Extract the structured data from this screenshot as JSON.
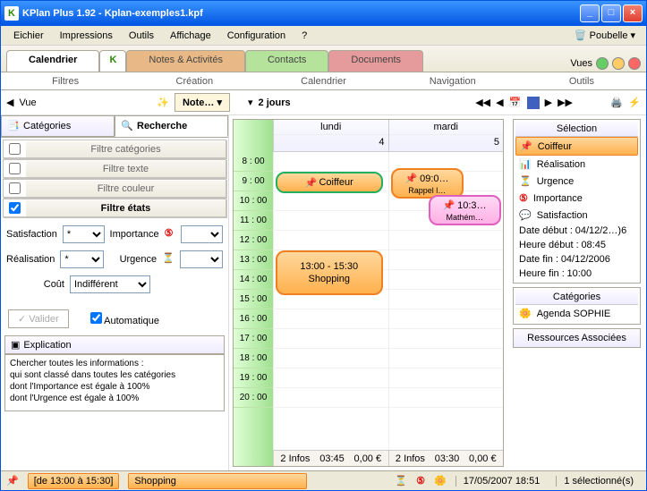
{
  "title": "KPlan Plus 1.92 - Kplan-exemples1.kpf",
  "menu": {
    "eichier": "Eichier",
    "impressions": "Impressions",
    "outils": "Outils",
    "affichage": "Affichage",
    "configuration": "Configuration",
    "help": "?",
    "poubelle": "Poubelle"
  },
  "main_tabs": {
    "calendrier": "Calendrier",
    "notes": "Notes & Activités",
    "contacts": "Contacts",
    "documents": "Documents",
    "vues": "Vues"
  },
  "subheader": {
    "filtres": "Filtres",
    "creation": "Création",
    "calendrier": "Calendrier",
    "navigation": "Navigation",
    "outils": "Outils"
  },
  "toolbar": {
    "vue": "Vue",
    "note": "Note…",
    "period": "2 jours"
  },
  "left": {
    "tabs": {
      "categories": "Catégories",
      "recherche": "Recherche"
    },
    "filters": {
      "cat": "Filtre catégories",
      "texte": "Filtre texte",
      "couleur": "Filtre couleur",
      "etats": "Filtre états"
    },
    "crit": {
      "satisfaction": "Satisfaction",
      "importance": "Importance",
      "realisation": "Réalisation",
      "urgence": "Urgence",
      "cout": "Coût",
      "star": "*",
      "indiff": "Indifférent"
    },
    "valider": "Valider",
    "auto": "Automatique",
    "explic_h": "Explication",
    "explic": "Chercher toutes les informations :\nqui sont classé dans  toutes les catégories\ndont l'Importance est égale à 100%\ndont l'Urgence est égale à 100%"
  },
  "calendar": {
    "days": [
      {
        "name": "lundi",
        "num": "4",
        "footer": {
          "infos": "2 Infos",
          "time": "03:45",
          "cost": "0,00 €"
        }
      },
      {
        "name": "mardi",
        "num": "5",
        "footer": {
          "infos": "2 Infos",
          "time": "03:30",
          "cost": "0,00 €"
        }
      }
    ],
    "hours": [
      "8 : 00",
      "9 : 00",
      "10 : 00",
      "11 : 00",
      "12 : 00",
      "13 : 00",
      "14 : 00",
      "15 : 00",
      "16 : 00",
      "17 : 00",
      "18 : 00",
      "19 : 00",
      "20 : 00"
    ],
    "events": {
      "coiffeur": "Coiffeur",
      "shopping_time": "13:00 - 15:30",
      "shopping": "Shopping",
      "rappel_t": "09:0…",
      "rappel": "Rappel l…",
      "math_t": "10:3…",
      "math": "Mathém…"
    }
  },
  "right": {
    "sel": "Sélection",
    "items": {
      "coiffeur": "Coiffeur",
      "realisation": "Réalisation",
      "urgence": "Urgence",
      "importance": "Importance",
      "satisfaction": "Satisfaction"
    },
    "date_debut_l": "Date début  :",
    "date_debut": "04/12/2…)6",
    "heure_debut_l": "Heure début :",
    "heure_debut": "08:45",
    "date_fin_l": "Date fin   :",
    "date_fin": "04/12/2006",
    "heure_fin_l": "Heure fin  :",
    "heure_fin": "10:00",
    "cat": "Catégories",
    "agenda": "Agenda SOPHIE",
    "ress": "Ressources Associées"
  },
  "status": {
    "range": "[de 13:00 à 15:30]",
    "label": "Shopping",
    "ts": "17/05/2007 18:51",
    "sel": "1 sélectionné(s)"
  }
}
